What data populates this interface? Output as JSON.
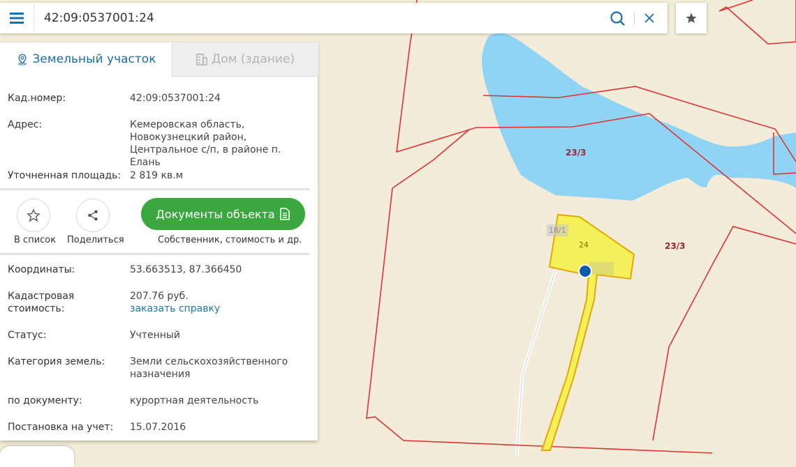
{
  "search": {
    "query": "42:09:0537001:24"
  },
  "tabs": {
    "land": "Земельный участок",
    "house": "Дом (здание)"
  },
  "info": {
    "cad_label": "Кад.номер:",
    "cad_value": "42:09:0537001:24",
    "addr_label": "Адрес:",
    "addr_line1": "Кемеровская область,",
    "addr_line2": "Новокузнецкий район,",
    "addr_line3": "Центральное с/п, в районе п. Елань",
    "area_label": "Уточненная площадь:",
    "area_value": "2 819 кв.м",
    "coord_label": "Координаты:",
    "coord_value": "53.663513, 87.366450",
    "cost_label1": "Кадастровая",
    "cost_label2": "стоимость:",
    "cost_value": "207.76 руб.",
    "cost_link": "заказать справку",
    "status_label": "Статус:",
    "status_value": "Учтенный",
    "cat_label": "Категория земель:",
    "cat_line1": "Земли сельскохозяйственного",
    "cat_line2": "назначения",
    "doc_label": "по документу:",
    "doc_value": "курортная деятельность",
    "reg_label": "Постановка на учет:",
    "reg_value": "15.07.2016"
  },
  "actions": {
    "list_label": "В список",
    "share_label": "Поделиться",
    "docs_button": "Документы объекта",
    "docs_sub": "Собственник, стоимость и др."
  },
  "map": {
    "labels": {
      "plot_23_3_a": "23/3",
      "plot_23_3_b": "23/3",
      "plot_24": "24",
      "plot_18_1": "18/1"
    },
    "colors": {
      "boundary": "#e03232",
      "water": "#8fd3f5",
      "selected": "#f4f05a",
      "ground": "#f2ecd8"
    }
  }
}
